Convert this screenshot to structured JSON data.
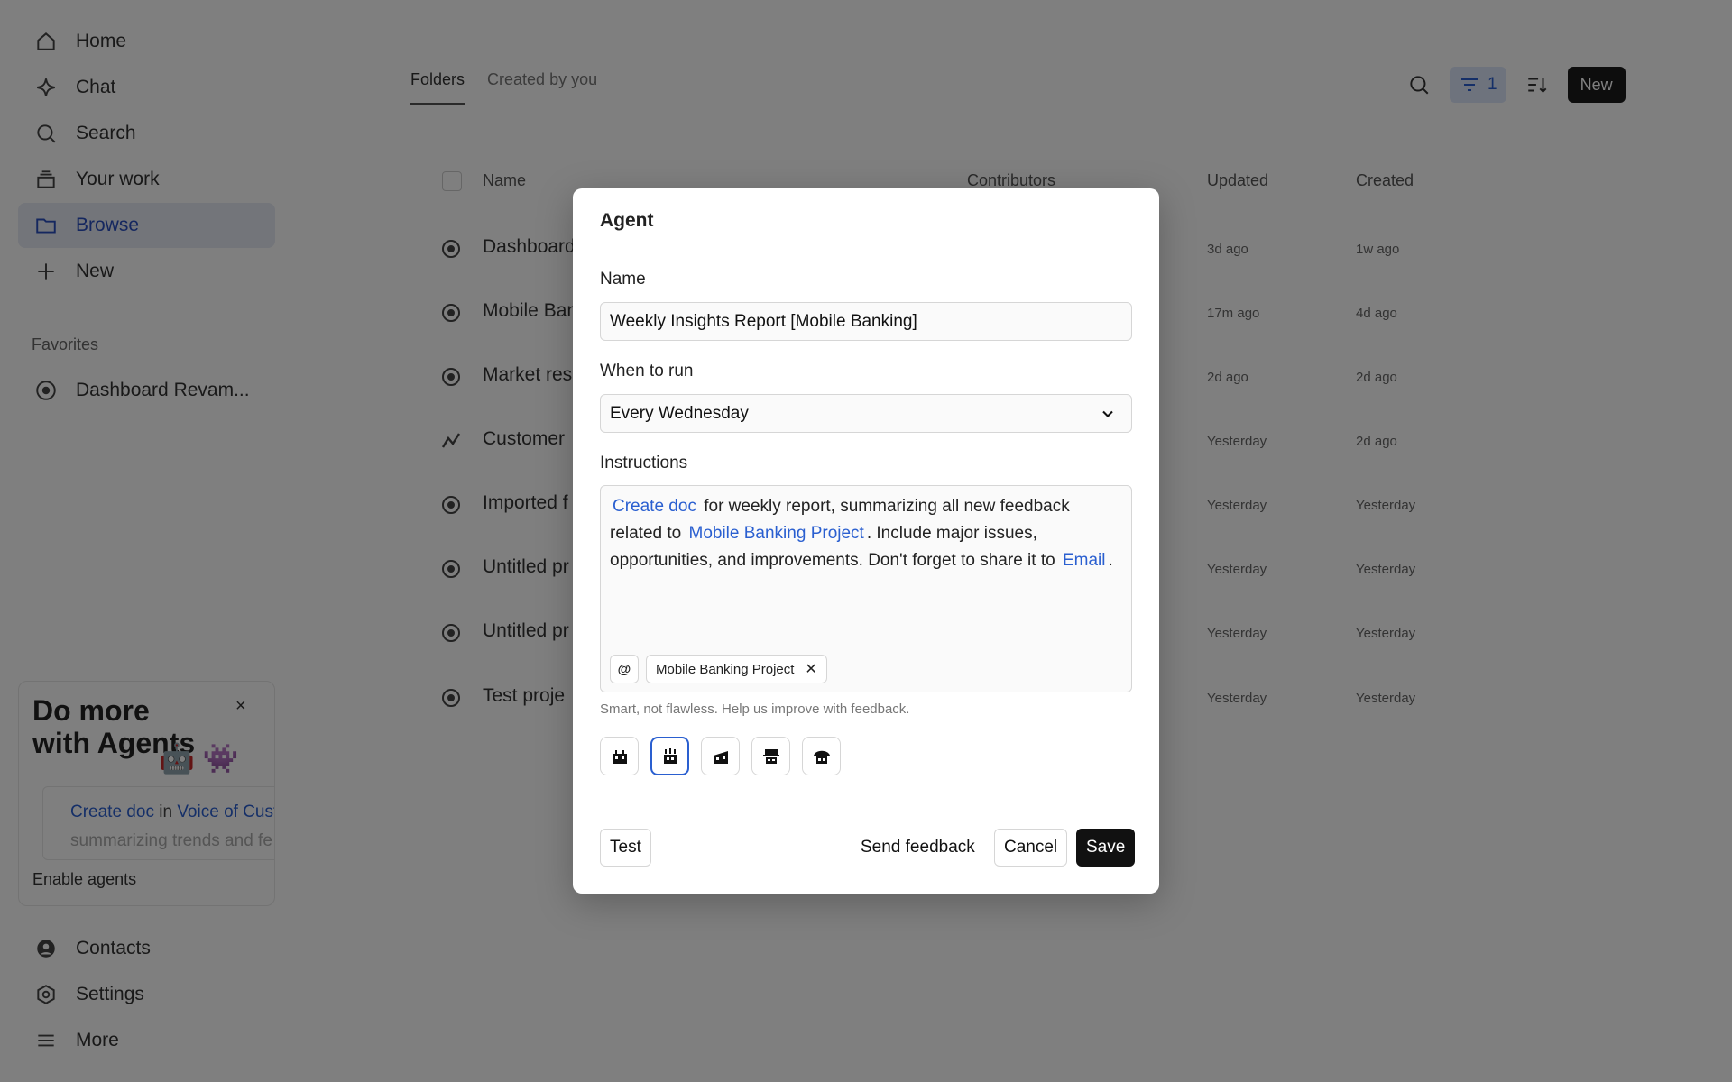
{
  "sidebar": {
    "nav": [
      {
        "label": "Home",
        "icon": "home-icon"
      },
      {
        "label": "Chat",
        "icon": "sparkle-icon"
      },
      {
        "label": "Search",
        "icon": "search-icon"
      },
      {
        "label": "Your work",
        "icon": "stack-icon"
      },
      {
        "label": "Browse",
        "icon": "folder-icon"
      },
      {
        "label": "New",
        "icon": "plus-icon"
      }
    ],
    "favorites_heading": "Favorites",
    "favorites": [
      {
        "label": "Dashboard Revam...",
        "icon": "compass-icon"
      }
    ],
    "promo": {
      "title": "Do more with Agents",
      "close": "×",
      "bots": "🤖 👾",
      "snippet_link1": "Create doc",
      "snippet_in": " in ",
      "snippet_link2": "Voice of Cust",
      "snippet_line2": "summarizing trends and fe",
      "enable": "Enable agents"
    },
    "bottom": [
      {
        "label": "Contacts",
        "icon": "user-circle-icon"
      },
      {
        "label": "Settings",
        "icon": "settings-hex-icon"
      },
      {
        "label": "More",
        "icon": "menu-icon"
      }
    ]
  },
  "main": {
    "tabs": [
      {
        "label": "Folders",
        "active": true
      },
      {
        "label": "Created by you",
        "active": false
      }
    ],
    "toolbar": {
      "filter_count": "1",
      "new_label": "New"
    },
    "table": {
      "headers": {
        "name": "Name",
        "contributors": "Contributors",
        "updated": "Updated",
        "created": "Created"
      },
      "rows": [
        {
          "name": "Dashboard",
          "icon": "compass-icon",
          "updated": "3d ago",
          "created": "1w ago"
        },
        {
          "name": "Mobile Ban",
          "icon": "compass-icon",
          "updated": "17m ago",
          "created": "4d ago"
        },
        {
          "name": "Market res",
          "icon": "compass-icon",
          "updated": "2d ago",
          "created": "2d ago"
        },
        {
          "name": "Customer",
          "icon": "trend-icon",
          "updated": "Yesterday",
          "created": "2d ago"
        },
        {
          "name": "Imported f",
          "icon": "compass-icon",
          "updated": "Yesterday",
          "created": "Yesterday"
        },
        {
          "name": "Untitled pr",
          "icon": "compass-icon",
          "updated": "Yesterday",
          "created": "Yesterday"
        },
        {
          "name": "Untitled pr",
          "icon": "compass-icon",
          "updated": "Yesterday",
          "created": "Yesterday"
        },
        {
          "name": "Test proje",
          "icon": "compass-icon",
          "updated": "Yesterday",
          "created": "Yesterday"
        }
      ]
    }
  },
  "modal": {
    "title": "Agent",
    "name_label": "Name",
    "name_value": "Weekly Insights Report [Mobile Banking]",
    "when_label": "When to run",
    "when_value": "Every Wednesday",
    "instructions_label": "Instructions",
    "instructions": {
      "link1": "Create doc",
      "text1": " for weekly report, summarizing all new feedback related to ",
      "link2": "Mobile Banking Project",
      "text2": ". Include major issues, opportunities, and improvements. Don't forget to share it to ",
      "link3": "Email",
      "text3": "."
    },
    "at_symbol": "@",
    "chip_label": "Mobile Banking Project",
    "hint": "Smart, not flawless. Help us improve with feedback.",
    "avatars": [
      "robot-avatar-1",
      "robot-avatar-2",
      "robot-avatar-3",
      "robot-avatar-4",
      "robot-avatar-5"
    ],
    "selected_avatar": 1,
    "buttons": {
      "test": "Test",
      "send_feedback": "Send feedback",
      "cancel": "Cancel",
      "save": "Save"
    },
    "colors": {
      "accent": "#2a5fd0",
      "primary_button": "#111111"
    }
  }
}
